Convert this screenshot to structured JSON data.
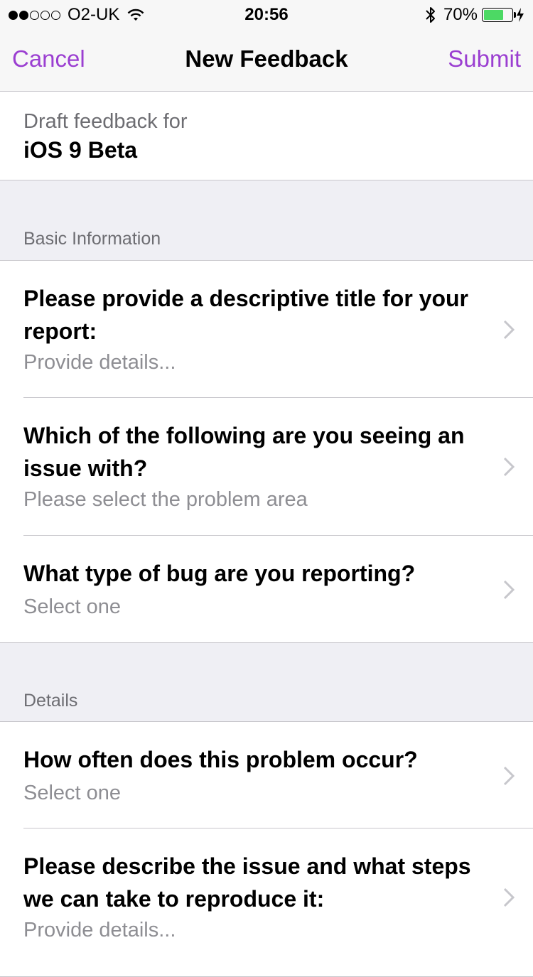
{
  "status_bar": {
    "carrier": "O2-UK",
    "time": "20:56",
    "battery_percent": "70%",
    "battery_level": 0.7,
    "signal_bars_filled": 2,
    "signal_bars_total": 5
  },
  "nav": {
    "cancel_label": "Cancel",
    "title": "New Feedback",
    "submit_label": "Submit",
    "accent_color": "#9b3fd1"
  },
  "draft": {
    "label": "Draft feedback for",
    "value": "iOS 9 Beta"
  },
  "sections": [
    {
      "header": "Basic Information",
      "rows": [
        {
          "title_line1": "Please provide a descriptive title for your",
          "title_line2": "report:",
          "subtitle": "Provide details..."
        },
        {
          "title_line1": "Which of the following are you seeing an",
          "title_line2": "issue with?",
          "subtitle": "Please select the problem area"
        },
        {
          "title_line1": "What type of bug are you reporting?",
          "subtitle": "Select one"
        }
      ]
    },
    {
      "header": "Details",
      "rows": [
        {
          "title_line1": "How often does this problem occur?",
          "subtitle": "Select one"
        },
        {
          "title_line1": "Please describe the issue and what steps",
          "title_line2": "we can take to reproduce it:",
          "subtitle": "Provide details..."
        }
      ]
    }
  ],
  "icons": {
    "wifi": "wifi-icon",
    "bluetooth": "bluetooth-icon",
    "battery": "battery-icon",
    "charging": "charging-bolt-icon",
    "chevron": "chevron-right-icon"
  }
}
